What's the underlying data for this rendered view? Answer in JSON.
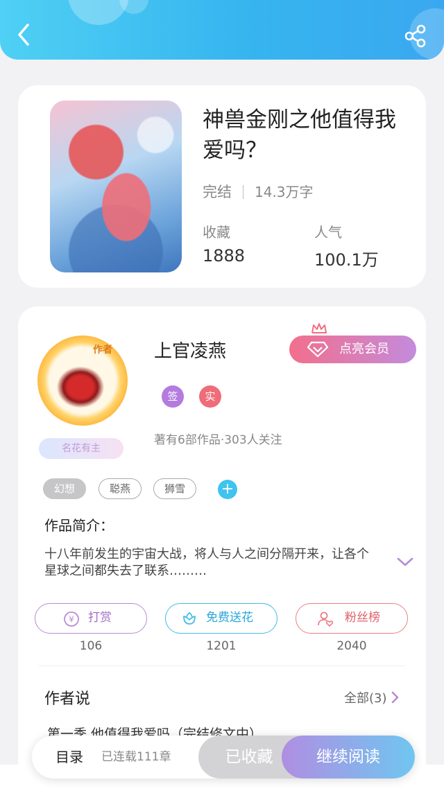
{
  "book": {
    "title": "神兽金刚之他值得我爱吗？",
    "status": "完结",
    "word_count": "14.3万字",
    "favorites_label": "收藏",
    "favorites_value": "1888",
    "popularity_label": "人气",
    "popularity_value": "100.1万"
  },
  "author": {
    "avatar_tag": "作者",
    "name": "上官凌燕",
    "vip_button": "点亮会员",
    "badge_sign": "签",
    "badge_real": "实",
    "works_info": "著有6部作品·303人关注",
    "title_badge": "名花有主"
  },
  "tags": [
    "幻想",
    "聪燕",
    "狮雪"
  ],
  "intro": {
    "heading": "作品简介：",
    "text": "十八年前发生的宇宙大战，将人与人之间分隔开来，让各个星球之间都失去了联系………"
  },
  "actions": [
    {
      "label": "打赏",
      "count": "106"
    },
    {
      "label": "免费送花",
      "count": "1201"
    },
    {
      "label": "粉丝榜",
      "count": "2040"
    }
  ],
  "author_says": {
    "heading": "作者说",
    "all_label": "全部(3)",
    "first_item": "第一季 他值得我爱吗（完结修文中）"
  },
  "bottom_bar": {
    "toc": "目录",
    "serial_info": "已连载111章",
    "favorited": "已收藏",
    "continue_reading": "继续阅读"
  },
  "colors": {
    "header": "#36b5ef",
    "vip_gradient_start": "#f26f8c",
    "vip_gradient_end": "#c48bdc",
    "reward": "#b98bd6",
    "flower": "#45bce6",
    "fans": "#ec8085"
  }
}
